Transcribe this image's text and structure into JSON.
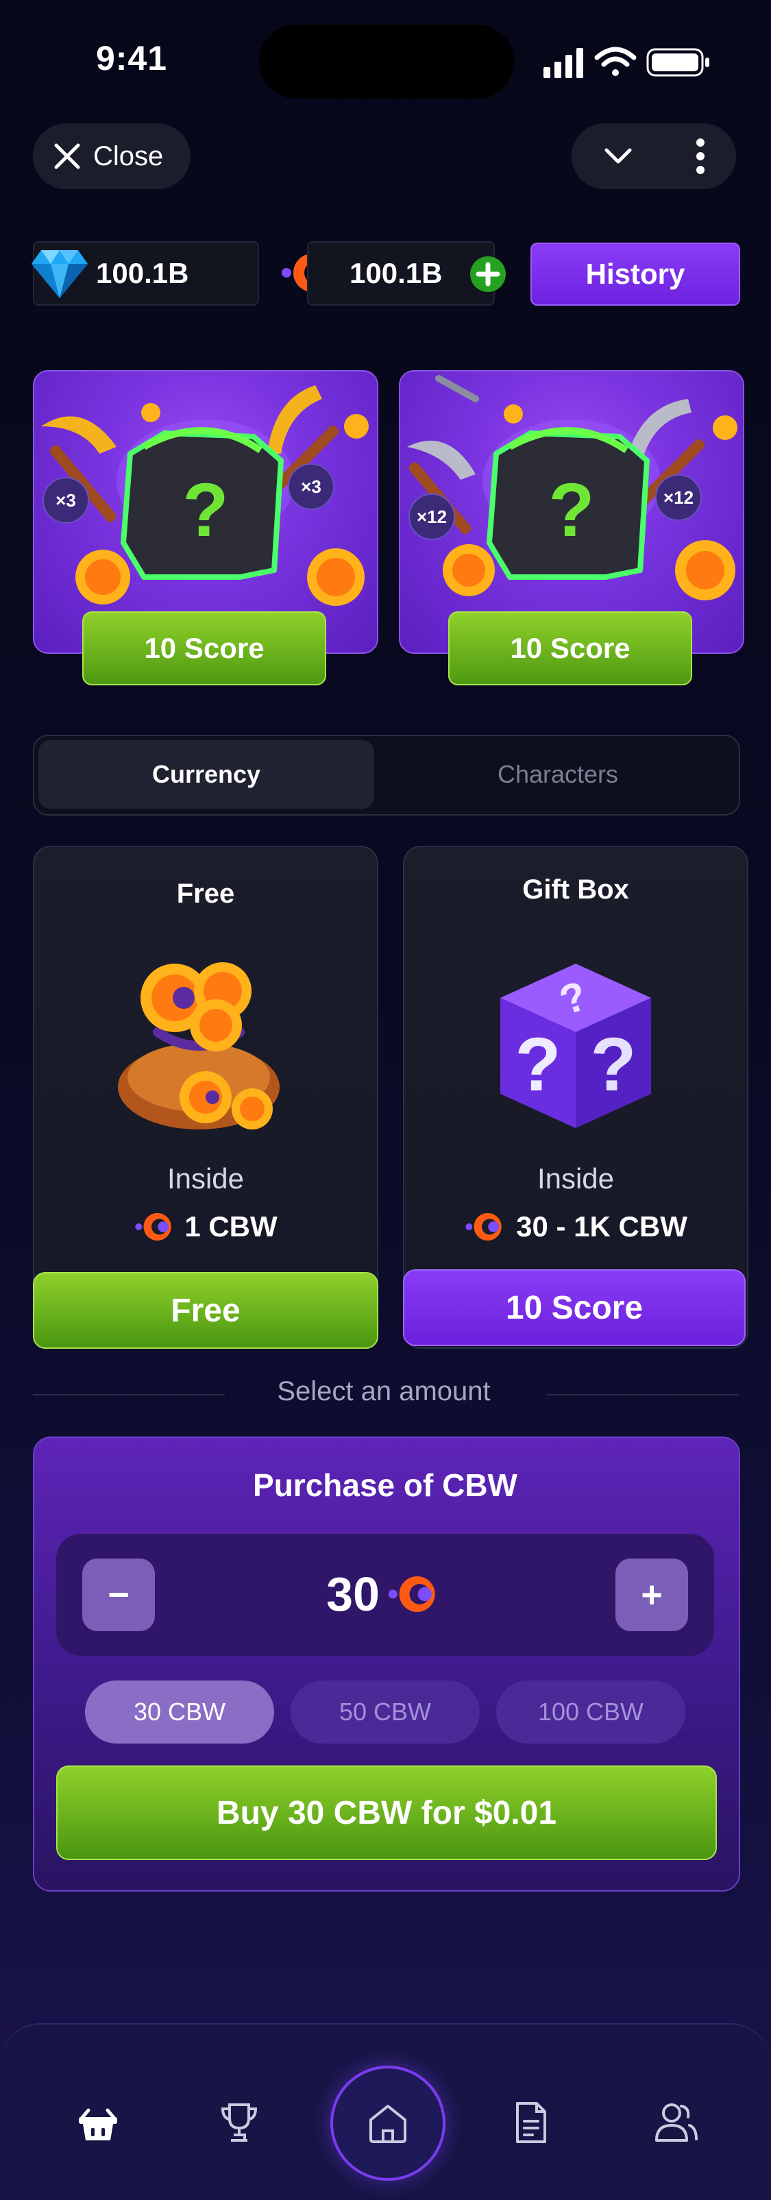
{
  "status_bar": {
    "time": "9:41"
  },
  "top_bar": {
    "close_label": "Close"
  },
  "balances": {
    "diamonds": "100.1B",
    "coins": "100.1B",
    "history_label": "History"
  },
  "promo_cards": [
    {
      "multiplier_left": "×3",
      "multiplier_right": "×3",
      "button_label": "10 Score"
    },
    {
      "multiplier_left": "×12",
      "multiplier_right": "×12",
      "button_label": "10 Score"
    }
  ],
  "tabs": [
    {
      "label": "Currency",
      "active": true
    },
    {
      "label": "Characters",
      "active": false
    }
  ],
  "items": [
    {
      "title": "Free",
      "inside_label": "Inside",
      "inside_value": "1 CBW",
      "button_label": "Free"
    },
    {
      "title": "Gift Box",
      "inside_label": "Inside",
      "inside_value": "30 - 1K CBW",
      "button_label": "10 Score"
    }
  ],
  "divider_text": "Select an amount",
  "purchase": {
    "title": "Purchase of CBW",
    "amount": "30",
    "minus_label": "−",
    "plus_label": "+",
    "options": [
      {
        "label": "30 CBW",
        "selected": true
      },
      {
        "label": "50 CBW",
        "selected": false
      },
      {
        "label": "100 CBW",
        "selected": false
      }
    ],
    "buy_label": "Buy 30 CBW for $0.01"
  },
  "nav": {
    "items": [
      "shop-icon",
      "trophy-icon",
      "home-icon",
      "document-icon",
      "friends-icon"
    ],
    "active": "home-icon"
  },
  "colors": {
    "accent_purple": "#7a34e0",
    "accent_green": "#6fb81e",
    "coin_orange": "#ff6a1a",
    "background": "#07081a"
  }
}
